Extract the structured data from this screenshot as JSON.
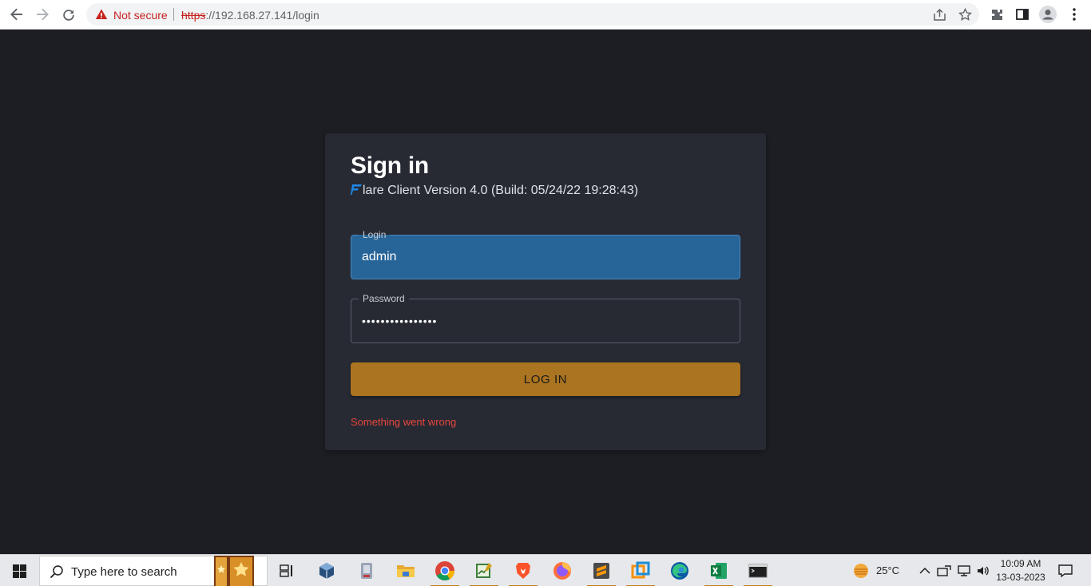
{
  "browser": {
    "security_label": "Not secure",
    "url_scheme": "https",
    "url_rest": "://192.168.27.141/login"
  },
  "signin": {
    "title": "Sign in",
    "version_text": "lare Client Version 4.0 (Build: 05/24/22 19:28:43)",
    "login_label": "Login",
    "login_value": "admin",
    "password_label": "Password",
    "password_value": "••••••••••••••••",
    "login_button": "LOG IN",
    "error_message": "Something went wrong"
  },
  "taskbar": {
    "search_placeholder": "Type here to search",
    "temperature": "25°C",
    "time": "10:09 AM",
    "date": "13-03-2023",
    "apps": [
      "task-view",
      "virtualbox",
      "app-generic",
      "file-explorer",
      "chrome",
      "app-chart",
      "brave",
      "firefox",
      "sublime-text",
      "virtualbox-manager",
      "edge",
      "excel",
      "terminal"
    ]
  },
  "colors": {
    "page_bg": "#1c1e24",
    "card_bg": "#272a33",
    "login_field_bg": "#276497",
    "button_bg": "#ab7420",
    "error": "#e8453c",
    "logo_blue": "#1e88e5"
  }
}
